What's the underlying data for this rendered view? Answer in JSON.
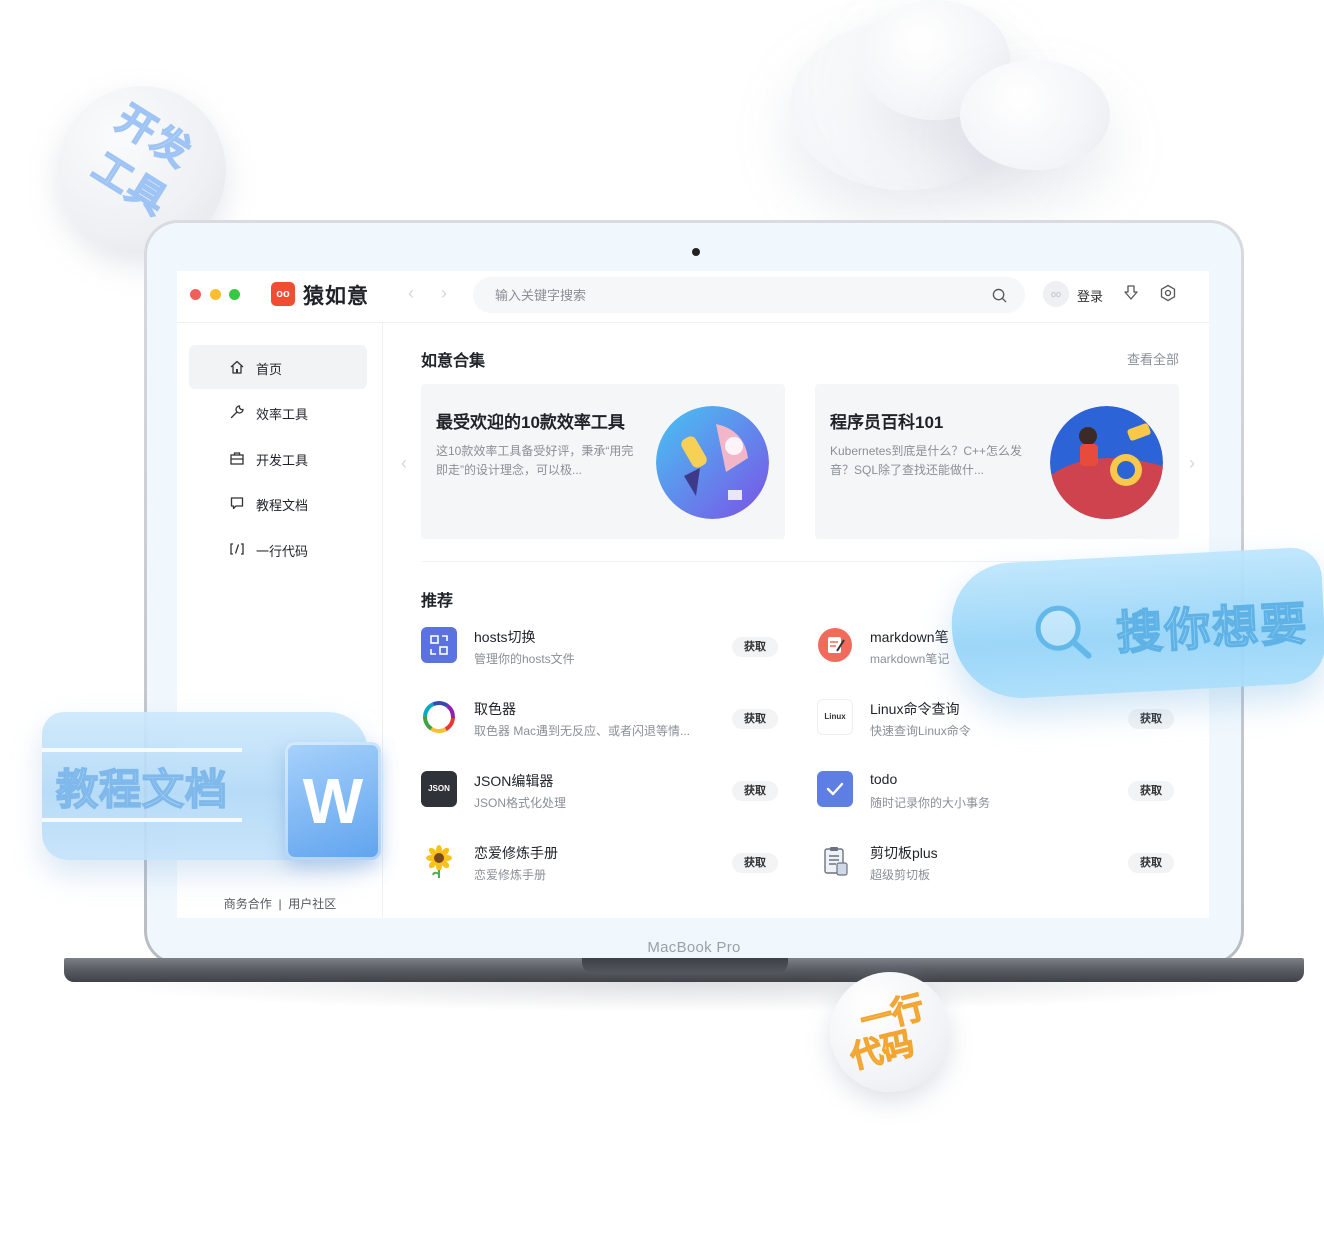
{
  "badges": {
    "dev_tools": [
      "开发",
      "工具"
    ],
    "one_line_code": [
      "一行",
      "代码"
    ]
  },
  "device": {
    "label": "MacBook Pro"
  },
  "app": {
    "logo_mark": "oo",
    "title": "猿如意",
    "search_placeholder": "输入关键字搜索",
    "avatar_text": "oo",
    "login_label": "登录"
  },
  "sidebar": {
    "items": [
      {
        "label": "首页",
        "icon": "home-icon",
        "active": true
      },
      {
        "label": "效率工具",
        "icon": "wrench-icon"
      },
      {
        "label": "开发工具",
        "icon": "toolbox-icon"
      },
      {
        "label": "教程文档",
        "icon": "chat-doc-icon"
      },
      {
        "label": "一行代码",
        "icon": "code-icon"
      }
    ],
    "footer_business": "商务合作",
    "footer_sep": "|",
    "footer_community": "用户社区"
  },
  "collections": {
    "title": "如意合集",
    "view_all": "查看全部",
    "cards": [
      {
        "title": "最受欢迎的10款效率工具",
        "desc": "这10款效率工具备受好评，秉承“用完即走”的设计理念，可以极..."
      },
      {
        "title": "程序员百科101",
        "desc": "Kubernetes到底是什么？C++怎么发音？SQL除了查找还能做什..."
      }
    ]
  },
  "recommend": {
    "title": "推荐",
    "get_label": "获取",
    "left": [
      {
        "name": "hosts切换",
        "desc": "管理你的hosts文件",
        "icon": "hosts-switch-icon"
      },
      {
        "name": "取色器",
        "desc": "取色器 Mac遇到无反应、或者闪退等情...",
        "icon": "color-ring-icon"
      },
      {
        "name": "JSON编辑器",
        "desc": "JSON格式化处理",
        "icon": "json-icon",
        "icon_text": "JSON"
      },
      {
        "name": "恋爱修炼手册",
        "desc": "恋爱修炼手册",
        "icon": "sunflower-icon"
      }
    ],
    "right": [
      {
        "name": "markdown笔",
        "desc": "markdown笔记",
        "icon": "markdown-note-icon"
      },
      {
        "name": "Linux命令查询",
        "desc": "快速查询Linux命令",
        "icon": "linux-icon",
        "icon_text": "Linux"
      },
      {
        "name": "todo",
        "desc": "随时记录你的大小事务",
        "icon": "check-icon"
      },
      {
        "name": "剪切板plus",
        "desc": "超级剪切板",
        "icon": "clipboard-icon"
      }
    ]
  },
  "banners": {
    "docs": "教程文档",
    "docs_icon_letter": "W",
    "search": "搜你想要"
  },
  "colors": {
    "brand": "#f04d32",
    "traffic_red": "#f25f58",
    "traffic_yellow": "#fbbe2e",
    "traffic_green": "#39c841",
    "hosts_icon": "#5b72e0",
    "todo_icon": "#5f7ee3"
  }
}
